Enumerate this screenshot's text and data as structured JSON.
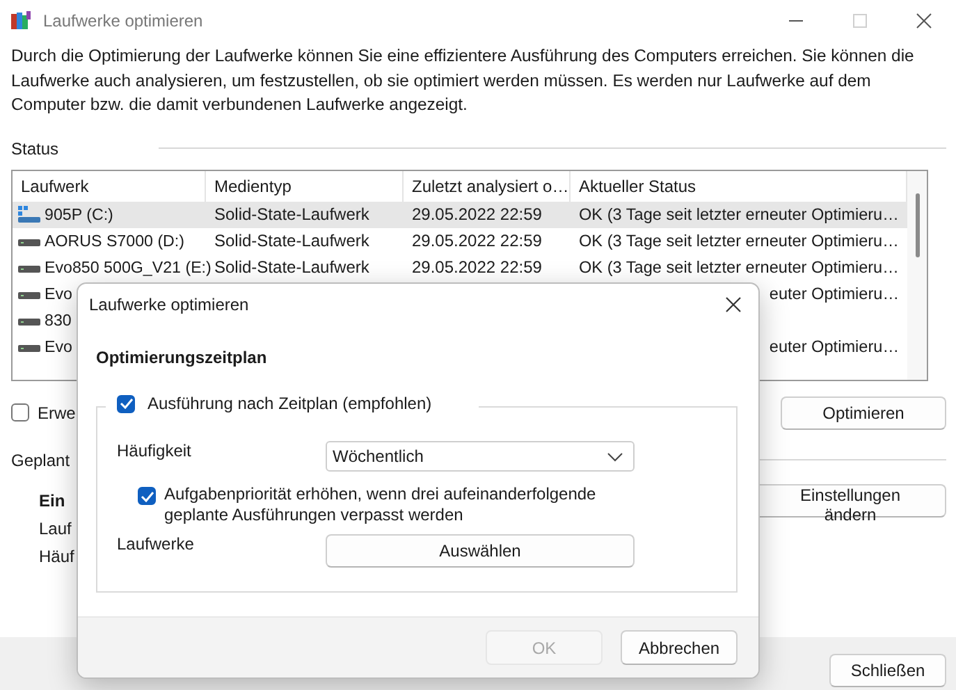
{
  "window": {
    "title": "Laufwerke optimieren",
    "controls": [
      {
        "kind": "minimize",
        "disabled": false
      },
      {
        "kind": "maximize",
        "disabled": true
      },
      {
        "kind": "close",
        "disabled": false
      }
    ]
  },
  "description": "Durch die Optimierung der Laufwerke können Sie eine effizientere Ausführung des Computers erreichen. Sie können die Laufwerke auch analysieren, um festzustellen, ob sie optimiert werden müssen. Es werden nur Laufwerke auf dem Computer bzw. die damit verbundenen Laufwerke angezeigt.",
  "status": {
    "label": "Status",
    "table": {
      "columns": [
        "Laufwerk",
        "Medientyp",
        "Zuletzt analysiert o…",
        "Aktueller Status"
      ],
      "rows": [
        {
          "kind": "system",
          "selected": true,
          "cells": [
            "905P (C:)",
            "Solid-State-Laufwerk",
            "29.05.2022 22:59",
            "OK (3 Tage seit letzter erneuter Optimieru…"
          ]
        },
        {
          "kind": "disk",
          "selected": false,
          "cells": [
            "AORUS S7000 (D:)",
            "Solid-State-Laufwerk",
            "29.05.2022 22:59",
            "OK (3 Tage seit letzter erneuter Optimieru…"
          ]
        },
        {
          "kind": "disk",
          "selected": false,
          "cells": [
            "Evo850 500G_V21 (E:)",
            "Solid-State-Laufwerk",
            "29.05.2022 22:59",
            "OK (3 Tage seit letzter erneuter Optimieru…"
          ]
        },
        {
          "kind": "disk",
          "selected": false,
          "cells": [
            "Evo",
            "",
            "",
            "euter Optimieru…"
          ]
        },
        {
          "kind": "disk",
          "selected": false,
          "cells": [
            "830",
            "",
            "",
            ""
          ]
        },
        {
          "kind": "disk",
          "selected": false,
          "cells": [
            "Evo",
            "",
            "",
            "euter Optimieru…"
          ]
        }
      ]
    },
    "advanced": {
      "label": "Erwe",
      "checked": false
    },
    "optimize_button": "Optimieren"
  },
  "schedule": {
    "label": "Geplant",
    "state": "Ein",
    "lines": [
      "Lauf",
      "Häuf"
    ],
    "change_button": "Einstellungen ändern"
  },
  "close_button": "Schließen",
  "dialog": {
    "title": "Laufwerke optimieren",
    "heading": "Optimierungszeitplan",
    "run_on_schedule": {
      "label": "Ausführung nach Zeitplan (empfohlen)",
      "checked": true
    },
    "frequency": {
      "label": "Häufigkeit",
      "value": "Wöchentlich"
    },
    "priority": {
      "label": "Aufgabenpriorität erhöhen, wenn drei aufeinanderfolgende geplante Ausführungen verpasst werden",
      "checked": true
    },
    "drives": {
      "label": "Laufwerke",
      "button": "Auswählen"
    },
    "buttons": [
      {
        "label": "OK",
        "disabled": true
      },
      {
        "label": "Abbrechen",
        "disabled": false
      }
    ]
  }
}
